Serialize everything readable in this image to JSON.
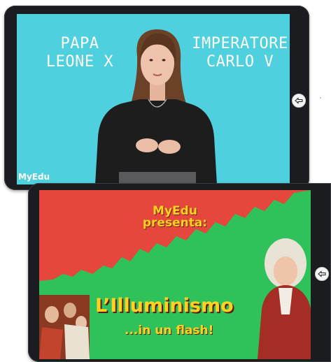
{
  "video_1": {
    "left_name": "PAPA\nLEONE X",
    "right_name": "IMPERATORE\nCARLO V",
    "brand": "MyEdu"
  },
  "video_2": {
    "brand_line": "MyEdu\npresenta:",
    "title": "L’Illuminismo",
    "subtitle": "...in un flash!"
  },
  "colors": {
    "screen_1_bg": "#4fd0de",
    "poster_red": "#e5473c",
    "poster_green": "#2fc25a",
    "poster_yellow": "#ffd21f"
  },
  "icons": {
    "home_button": "arrow-left-icon"
  }
}
